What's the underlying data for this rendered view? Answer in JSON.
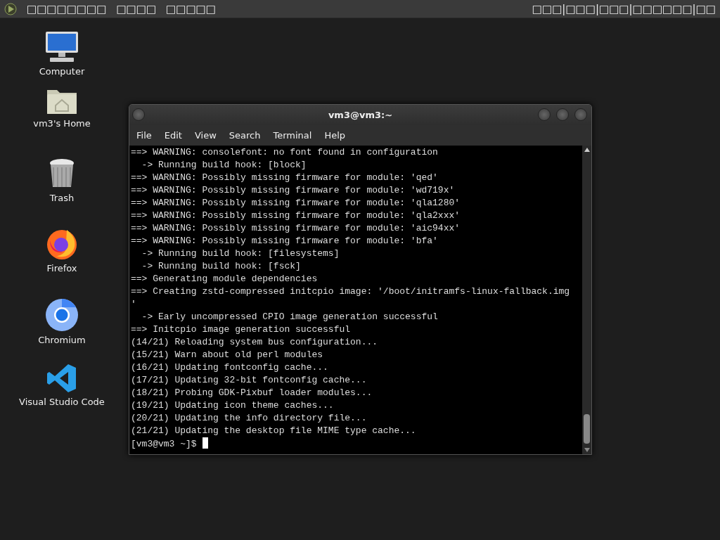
{
  "top_bar": {
    "menus": [
      "□□□□□□□□",
      "□□□□",
      "□□□□□"
    ],
    "clock": "□□□|□□□|□□□|□□□□□□|□□"
  },
  "desktop_icons": [
    {
      "kind": "computer",
      "label": "Computer"
    },
    {
      "kind": "home",
      "label": "vm3's Home"
    },
    {
      "kind": "trash",
      "label": "Trash"
    },
    {
      "kind": "firefox",
      "label": "Firefox"
    },
    {
      "kind": "chromium",
      "label": "Chromium"
    },
    {
      "kind": "vscode",
      "label": "Visual Studio Code"
    }
  ],
  "terminal": {
    "title": "vm3@vm3:~",
    "menu": [
      "File",
      "Edit",
      "View",
      "Search",
      "Terminal",
      "Help"
    ],
    "lines": [
      "==> WARNING: consolefont: no font found in configuration",
      "  -> Running build hook: [block]",
      "==> WARNING: Possibly missing firmware for module: 'qed'",
      "==> WARNING: Possibly missing firmware for module: 'wd719x'",
      "==> WARNING: Possibly missing firmware for module: 'qla1280'",
      "==> WARNING: Possibly missing firmware for module: 'qla2xxx'",
      "==> WARNING: Possibly missing firmware for module: 'aic94xx'",
      "==> WARNING: Possibly missing firmware for module: 'bfa'",
      "  -> Running build hook: [filesystems]",
      "  -> Running build hook: [fsck]",
      "==> Generating module dependencies",
      "==> Creating zstd-compressed initcpio image: '/boot/initramfs-linux-fallback.img",
      "'",
      "  -> Early uncompressed CPIO image generation successful",
      "==> Initcpio image generation successful",
      "(14/21) Reloading system bus configuration...",
      "(15/21) Warn about old perl modules",
      "(16/21) Updating fontconfig cache...",
      "(17/21) Updating 32-bit fontconfig cache...",
      "(18/21) Probing GDK-Pixbuf loader modules...",
      "(19/21) Updating icon theme caches...",
      "(20/21) Updating the info directory file...",
      "(21/21) Updating the desktop file MIME type cache..."
    ],
    "prompt": "[vm3@vm3 ~]$"
  }
}
